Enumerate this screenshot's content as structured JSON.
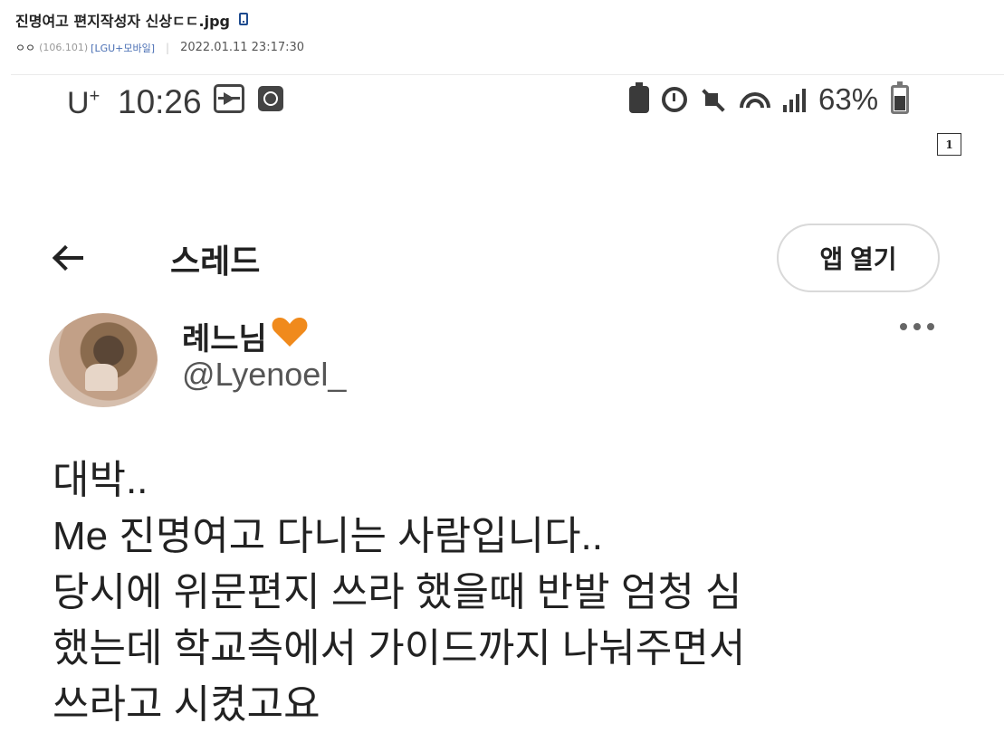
{
  "post": {
    "title": "진명여고 편지작성자 신상ㄷㄷ.jpg",
    "author_nick": "ㅇㅇ",
    "author_ip": "(106.101)",
    "author_carrier": "[LGU+모바일]",
    "separator": "|",
    "date": "2022.01.11 23:17:30"
  },
  "image_badge": "1",
  "status_bar": {
    "carrier": "U",
    "carrier_sup": "+",
    "time": "10:26",
    "battery_percent": "63%",
    "battery_level": 0.63,
    "icons": [
      "screen-record-icon",
      "clock-app-icon",
      "battery-saver-icon",
      "alarm-icon",
      "mute-icon",
      "wifi-icon",
      "signal-icon",
      "battery-icon"
    ]
  },
  "thread": {
    "title": "스레드",
    "open_app_label": "앱 열기"
  },
  "tweet": {
    "author_name": "례느님",
    "author_handle": "@Lyenoel_",
    "lines": [
      "대박..",
      "Me 진명여고 다니는 사람입니다..",
      "당시에 위문편지 쓰라 했을때 반발 엄청 심",
      "했는데 학교측에서 가이드까지 나눠주면서",
      "쓰라고 시켰고요"
    ]
  },
  "colors": {
    "heart": "#f08a1c",
    "carrier_link": "#4a6fb4",
    "text": "#222222"
  }
}
